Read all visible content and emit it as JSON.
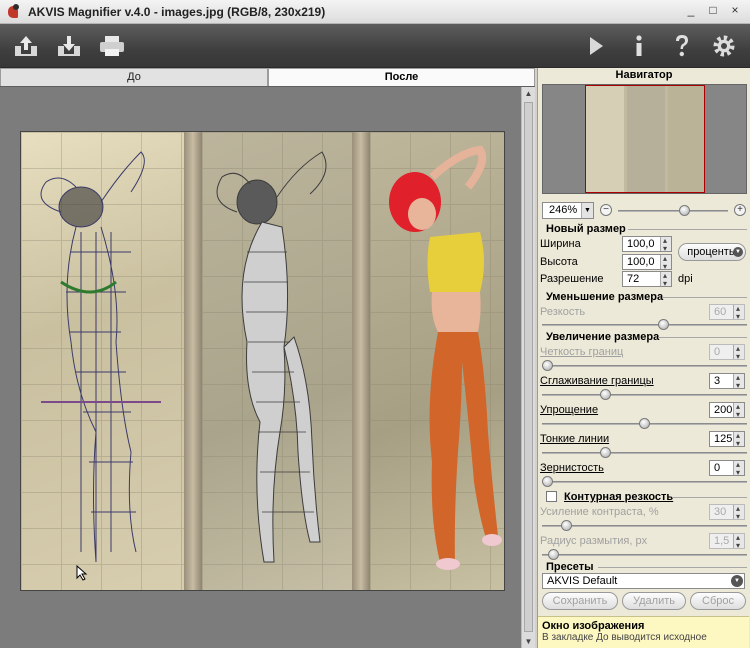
{
  "window": {
    "title": "AKVIS Magnifier v.4.0 - images.jpg (RGB/8, 230x219)",
    "controls": [
      "_",
      "□",
      "×"
    ]
  },
  "toolbar": {
    "left_icons": [
      "open-icon",
      "save-icon",
      "print-icon"
    ],
    "right_icons": [
      "run-icon",
      "info-icon",
      "help-icon",
      "settings-icon"
    ]
  },
  "tabs": {
    "before": "До",
    "after": "После"
  },
  "navigator": {
    "title": "Навигатор",
    "zoom": "246%",
    "zoom_out": "−",
    "zoom_in": "+",
    "zoom_level": 0.62
  },
  "new_size": {
    "title": "Новый размер",
    "width_label": "Ширина",
    "width_value": "100,0",
    "height_label": "Высота",
    "height_value": "100,0",
    "units": "проценты",
    "resolution_label": "Разрешение",
    "resolution_value": "72",
    "resolution_unit": "dpi"
  },
  "downsize": {
    "title": "Уменьшение размера",
    "sharpness_label": "Резкость",
    "sharpness_value": "60",
    "sharpness_level": 0.6
  },
  "upsize": {
    "title": "Увеличение размера",
    "items": [
      {
        "label": "Четкость границ",
        "value": "0",
        "disabled": true,
        "level": 0.0
      },
      {
        "label": "Сглаживание границы",
        "value": "3",
        "disabled": false,
        "level": 0.3
      },
      {
        "label": "Упрощение",
        "value": "200",
        "disabled": false,
        "level": 0.5
      },
      {
        "label": "Тонкие линии",
        "value": "125",
        "disabled": false,
        "level": 0.3
      },
      {
        "label": "Зернистость",
        "value": "0",
        "disabled": false,
        "level": 0.0
      }
    ]
  },
  "contour": {
    "title": "Контурная резкость",
    "checked": false,
    "items": [
      {
        "label": "Усиление контраста, %",
        "value": "30",
        "level": 0.1
      },
      {
        "label": "Радиус размытия, px",
        "value": "1,5",
        "level": 0.03
      }
    ]
  },
  "presets": {
    "title": "Пресеты",
    "selected": "AKVIS Default",
    "save": "Сохранить",
    "delete": "Удалить",
    "reset": "Сброс"
  },
  "info": {
    "title": "Окно изображения",
    "text": "В закладке До выводится исходное"
  }
}
